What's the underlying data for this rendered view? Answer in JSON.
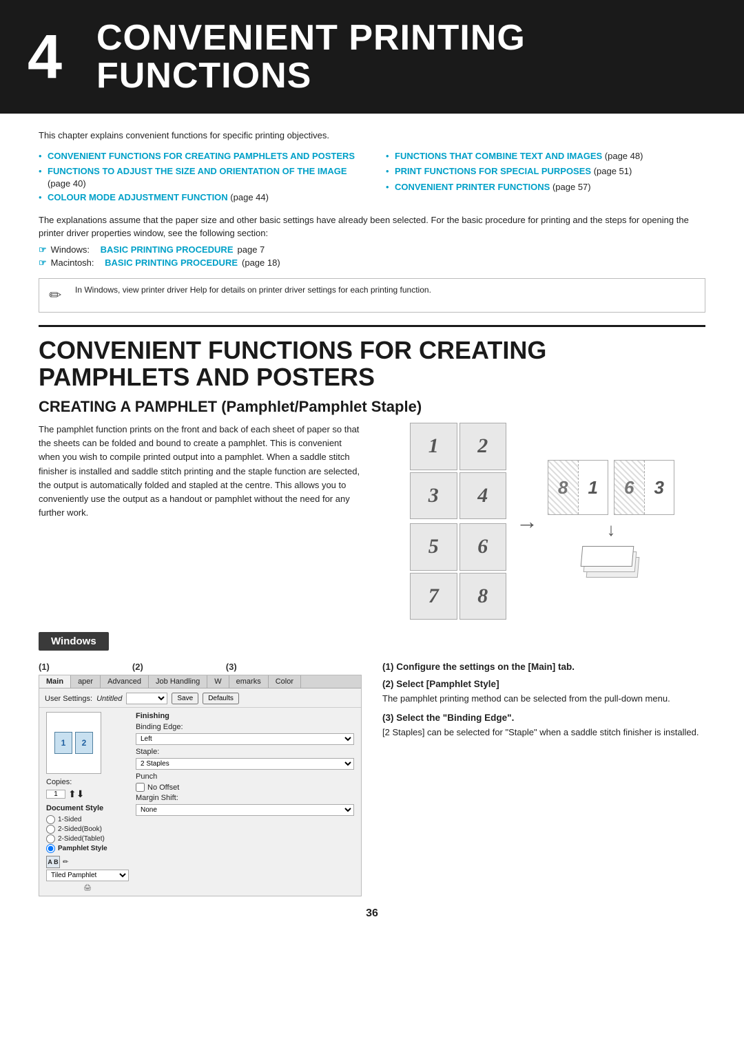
{
  "chapter": {
    "number": "4",
    "title_line1": "CONVENIENT PRINTING",
    "title_line2": "FUNCTIONS"
  },
  "intro": {
    "text": "This chapter explains convenient functions for specific printing objectives."
  },
  "toc": {
    "left": [
      {
        "link": "CONVENIENT FUNCTIONS FOR CREATING PAMPHLETS AND POSTERS",
        "suffix": ""
      },
      {
        "link": "FUNCTIONS TO ADJUST THE SIZE AND ORIENTATION OF THE IMAGE",
        "suffix": " (page 40)"
      },
      {
        "link": "COLOUR MODE ADJUSTMENT FUNCTION",
        "suffix": " (page 44)"
      }
    ],
    "right": [
      {
        "link": "FUNCTIONS THAT COMBINE TEXT AND IMAGES",
        "suffix": " (page 48)"
      },
      {
        "link": "PRINT FUNCTIONS FOR SPECIAL PURPOSES",
        "suffix": " (page 51)"
      },
      {
        "link": "CONVENIENT PRINTER FUNCTIONS",
        "suffix": " (page 57)"
      }
    ]
  },
  "procedure": {
    "text": "The explanations assume that the paper size and other basic settings have already been selected. For the basic procedure for printing and the steps for opening the printer driver properties window, see the following section:",
    "windows_label": "Windows:",
    "windows_link": "BASIC PRINTING PROCEDURE",
    "windows_page": " page 7",
    "mac_label": "Macintosh:",
    "mac_link": "BASIC PRINTING PROCEDURE",
    "mac_page": " (page 18)"
  },
  "note": {
    "text": "In Windows, view printer driver Help for details on printer driver settings for each printing function."
  },
  "main_section": {
    "title_line1": "CONVENIENT FUNCTIONS FOR CREATING",
    "title_line2": "PAMPHLETS AND POSTERS"
  },
  "sub_section": {
    "title": "CREATING A PAMPHLET (Pamphlet/Pamphlet Staple)"
  },
  "pamphlet_text": "The pamphlet function prints on the front and back of each sheet of paper so that the sheets can be folded and bound to create a pamphlet. This is convenient when you wish to compile printed output into a pamphlet. When a saddle stitch finisher is installed and saddle stitch printing and the staple function are selected, the output is automatically folded and stapled at the centre. This allows you to conveniently use the output as a handout or pamphlet without the need for any further work.",
  "diagram": {
    "pages": [
      "1",
      "2",
      "3",
      "4",
      "5",
      "6",
      "7",
      "8"
    ],
    "result_top": [
      "8",
      "1",
      "6",
      "3"
    ],
    "arrow": "→",
    "down_arrow": "↓"
  },
  "windows_section": {
    "label": "Windows",
    "callouts": [
      "(1)",
      "(2)",
      "(3)"
    ],
    "dialog": {
      "tabs": [
        "Main",
        "aper",
        "Advanced",
        "Job Handling",
        "W",
        "emarks",
        "Color"
      ],
      "user_settings": "User Settings: Untitled",
      "save_btn": "Save",
      "defaults_btn": "Defaults",
      "copies_label": "Copies:",
      "copies_value": "1",
      "document_style_label": "Document Style",
      "radio_options": [
        "1-Sided",
        "2-Sided(Book)",
        "2-Sided(Tablet)",
        "Pamphlet Style"
      ],
      "pamphlet_style_select": "Tiled Pamphlet",
      "finishing_label": "Finishing",
      "binding_edge_label": "Binding Edge:",
      "binding_edge_value": "Left",
      "staple_label": "Staple:",
      "staple_value": "2 Staples",
      "punch_label": "Punch",
      "no_offset_label": "No Offset",
      "margin_shift_label": "Margin Shift:",
      "margin_shift_value": "None"
    }
  },
  "steps": {
    "step1": {
      "number": "(1)",
      "title": "Configure the settings on the [Main] tab."
    },
    "step2": {
      "number": "(2)",
      "title": "Select [Pamphlet Style]",
      "body": "The pamphlet printing method can be selected from the pull-down menu."
    },
    "step3": {
      "number": "(3)",
      "title": "Select the \"Binding Edge\".",
      "body": "[2 Staples] can be selected for \"Staple\" when a saddle stitch finisher is installed."
    }
  },
  "page_number": "36"
}
